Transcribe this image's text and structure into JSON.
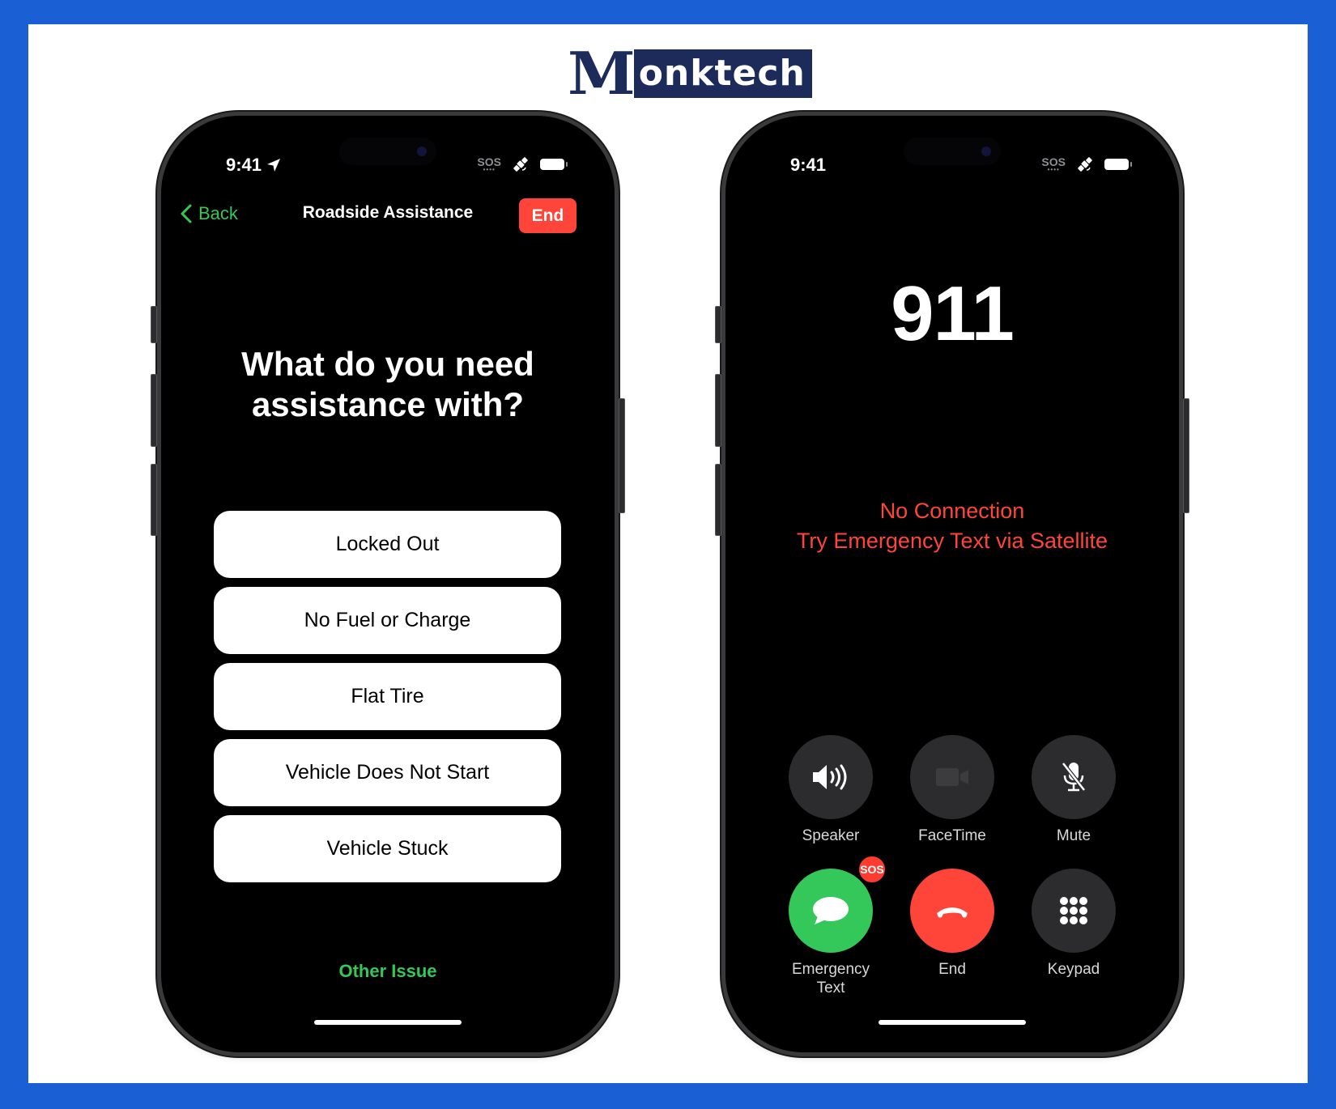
{
  "brand": {
    "logo_initial": "M",
    "logo_rest": "onktech"
  },
  "colors": {
    "background_frame": "#1a5fd3",
    "logo_navy": "#1c2b5a",
    "ios_green": "#34c759",
    "ios_red": "#ff453a",
    "control_gray": "#2c2c2e"
  },
  "left_phone": {
    "status_bar": {
      "time": "9:41",
      "location_icon": "location-arrow-icon",
      "sos_label": "SOS",
      "satellite_icon": "satellite-icon",
      "battery_icon": "battery-icon"
    },
    "nav": {
      "back_label": "Back",
      "title": "Roadside Assistance",
      "end_label": "End"
    },
    "question_line1": "What do you need",
    "question_line2": "assistance with?",
    "options": [
      {
        "label": "Locked Out"
      },
      {
        "label": "No Fuel or Charge"
      },
      {
        "label": "Flat Tire"
      },
      {
        "label": "Vehicle Does Not Start"
      },
      {
        "label": "Vehicle Stuck"
      }
    ],
    "other_issue_label": "Other Issue"
  },
  "right_phone": {
    "status_bar": {
      "time": "9:41",
      "sos_label": "SOS",
      "satellite_icon": "satellite-icon",
      "battery_icon": "battery-icon"
    },
    "callee": "911",
    "status_line1": "No Connection",
    "status_line2": "Try Emergency Text via Satellite",
    "controls": [
      {
        "label": "Speaker",
        "icon": "speaker-icon"
      },
      {
        "label": "FaceTime",
        "icon": "video-camera-icon",
        "disabled": true
      },
      {
        "label": "Mute",
        "icon": "mic-slash-icon"
      },
      {
        "label_line1": "Emergency",
        "label_line2": "Text",
        "icon": "message-bubble-icon",
        "badge": "SOS"
      },
      {
        "label": "End",
        "icon": "phone-hangup-icon"
      },
      {
        "label": "Keypad",
        "icon": "keypad-icon"
      }
    ]
  }
}
